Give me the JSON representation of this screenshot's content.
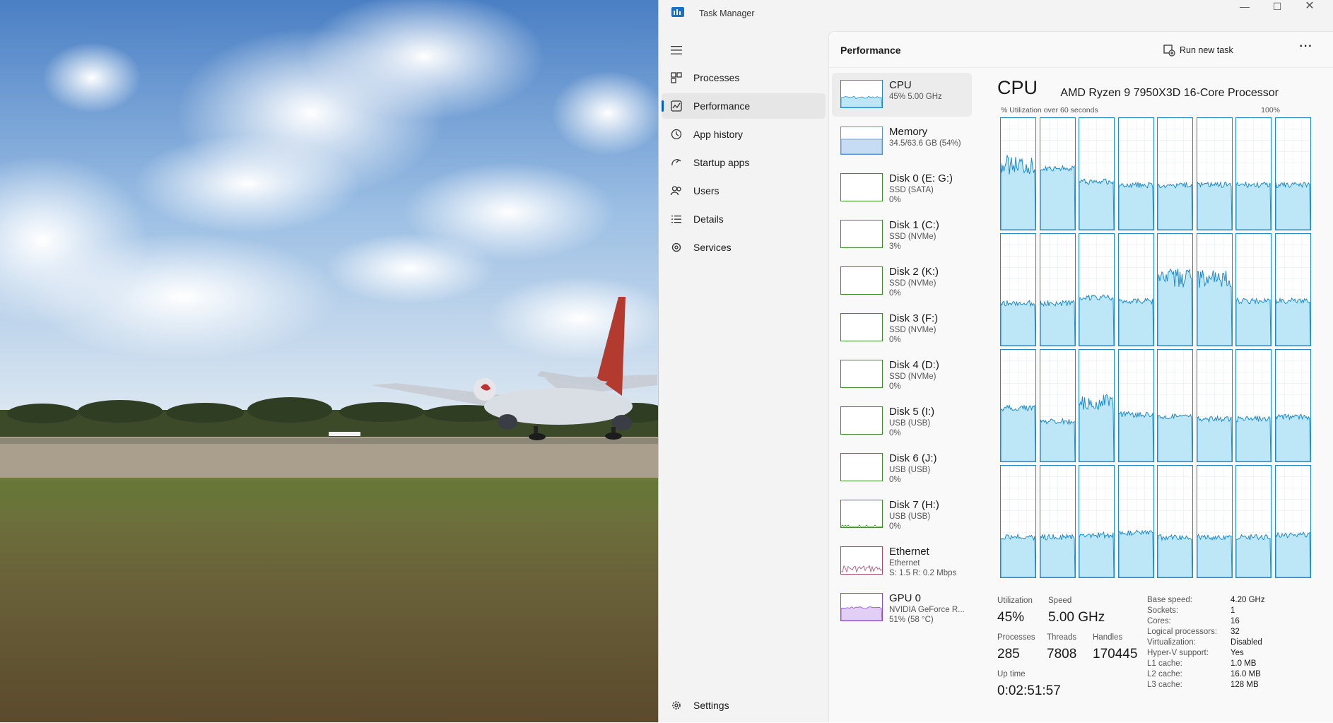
{
  "window": {
    "title": "Task Manager"
  },
  "nav": {
    "items": [
      {
        "label": "Processes",
        "icon": "processes-icon"
      },
      {
        "label": "Performance",
        "icon": "performance-icon",
        "selected": true
      },
      {
        "label": "App history",
        "icon": "app-history-icon"
      },
      {
        "label": "Startup apps",
        "icon": "startup-apps-icon"
      },
      {
        "label": "Users",
        "icon": "users-icon"
      },
      {
        "label": "Details",
        "icon": "details-icon"
      },
      {
        "label": "Services",
        "icon": "services-icon"
      }
    ],
    "settings": "Settings"
  },
  "header": {
    "title": "Performance",
    "run_new_task": "Run new task",
    "more": "···"
  },
  "devices": [
    {
      "name": "CPU",
      "lines": [
        "45% 5.00 GHz"
      ],
      "kind": "cpu",
      "selected": true
    },
    {
      "name": "Memory",
      "lines": [
        "34.5/63.6 GB (54%)"
      ],
      "kind": "memory"
    },
    {
      "name": "Disk 0 (E: G:)",
      "lines": [
        "SSD (SATA)",
        "0%"
      ],
      "kind": "disk"
    },
    {
      "name": "Disk 1 (C:)",
      "lines": [
        "SSD (NVMe)",
        "3%"
      ],
      "kind": "disk"
    },
    {
      "name": "Disk 2 (K:)",
      "lines": [
        "SSD (NVMe)",
        "0%"
      ],
      "kind": "disk"
    },
    {
      "name": "Disk 3 (F:)",
      "lines": [
        "SSD (NVMe)",
        "0%"
      ],
      "kind": "disk"
    },
    {
      "name": "Disk 4 (D:)",
      "lines": [
        "SSD (NVMe)",
        "0%"
      ],
      "kind": "disk"
    },
    {
      "name": "Disk 5 (I:)",
      "lines": [
        "USB (USB)",
        "0%"
      ],
      "kind": "disk"
    },
    {
      "name": "Disk 6 (J:)",
      "lines": [
        "USB (USB)",
        "0%"
      ],
      "kind": "disk"
    },
    {
      "name": "Disk 7 (H:)",
      "lines": [
        "USB (USB)",
        "0%"
      ],
      "kind": "disk7"
    },
    {
      "name": "Ethernet",
      "lines": [
        "Ethernet",
        "S: 1.5 R: 0.2 Mbps"
      ],
      "kind": "ethernet"
    },
    {
      "name": "GPU 0",
      "lines": [
        "NVIDIA GeForce R...",
        "51% (58 °C)"
      ],
      "kind": "gpu"
    }
  ],
  "cpu": {
    "heading": "CPU",
    "model": "AMD Ryzen 9 7950X3D 16-Core Processor",
    "graph_label": "% Utilization over 60 seconds",
    "graph_max": "100%",
    "core_levels": [
      0.58,
      0.55,
      0.43,
      0.4,
      0.4,
      0.4,
      0.4,
      0.4,
      0.38,
      0.38,
      0.43,
      0.4,
      0.6,
      0.6,
      0.4,
      0.4,
      0.48,
      0.36,
      0.53,
      0.42,
      0.4,
      0.38,
      0.38,
      0.4,
      0.36,
      0.36,
      0.38,
      0.4,
      0.36,
      0.36,
      0.36,
      0.38
    ],
    "colors": {
      "line": "#1d8bc9",
      "fill": "#bde6f7",
      "grid": "#e6eef3"
    }
  },
  "stats": {
    "utilization_label": "Utilization",
    "utilization": "45%",
    "speed_label": "Speed",
    "speed": "5.00 GHz",
    "processes_label": "Processes",
    "processes": "285",
    "threads_label": "Threads",
    "threads": "7808",
    "handles_label": "Handles",
    "handles": "170445",
    "uptime_label": "Up time",
    "uptime": "0:02:51:57"
  },
  "specs": [
    {
      "label": "Base speed:",
      "value": "4.20 GHz"
    },
    {
      "label": "Sockets:",
      "value": "1"
    },
    {
      "label": "Cores:",
      "value": "16"
    },
    {
      "label": "Logical processors:",
      "value": "32"
    },
    {
      "label": "Virtualization:",
      "value": "Disabled"
    },
    {
      "label": "Hyper-V support:",
      "value": "Yes"
    },
    {
      "label": "L1 cache:",
      "value": "1.0 MB"
    },
    {
      "label": "L2 cache:",
      "value": "16.0 MB"
    },
    {
      "label": "L3 cache:",
      "value": "128 MB"
    }
  ]
}
